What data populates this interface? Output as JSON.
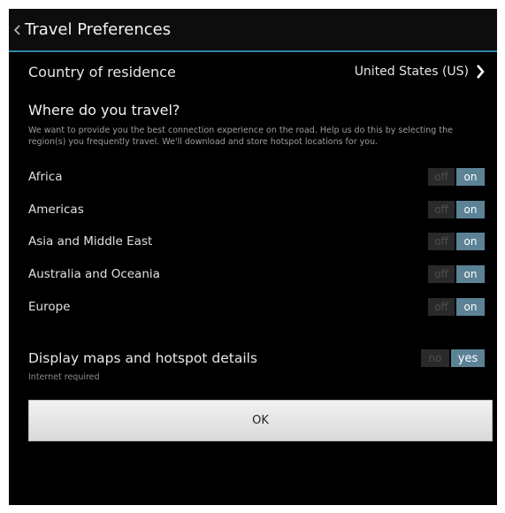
{
  "header": {
    "title": "Travel Preferences",
    "back_icon": "chevron-left-icon"
  },
  "country": {
    "label": "Country of residence",
    "value": "United States (US)",
    "icon": "chevron-right-icon"
  },
  "travel": {
    "heading": "Where do you travel?",
    "description": "We want to provide you the best connection experience on the road. Help us do this by selecting the region(s) you frequently travel. We'll download and store hotspot locations for you.",
    "regions": [
      {
        "label": "Africa",
        "off": "off",
        "on": "on",
        "state": "on"
      },
      {
        "label": "Americas",
        "off": "off",
        "on": "on",
        "state": "on"
      },
      {
        "label": "Asia and Middle East",
        "off": "off",
        "on": "on",
        "state": "on"
      },
      {
        "label": "Australia and Oceania",
        "off": "off",
        "on": "on",
        "state": "on"
      },
      {
        "label": "Europe",
        "off": "off",
        "on": "on",
        "state": "on"
      }
    ]
  },
  "maps": {
    "label": "Display maps and hotspot details",
    "note": "Internet required",
    "no": "no",
    "yes": "yes",
    "state": "yes"
  },
  "ok_label": "OK",
  "colors": {
    "accent": "#2f86a8",
    "toggle_on": "#5c8296",
    "background": "#000000"
  }
}
